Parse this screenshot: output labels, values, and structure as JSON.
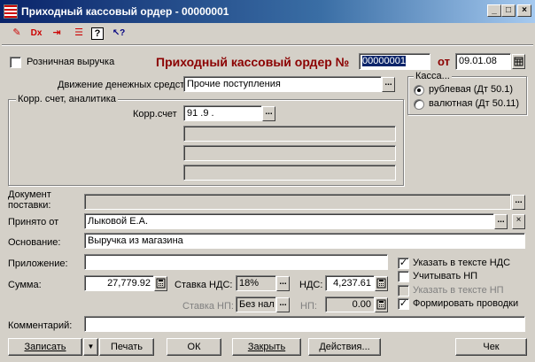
{
  "window": {
    "title": "Приходный кассовый ордер - 00000001",
    "minimize_icon": "_",
    "maximize_icon": "□",
    "close_icon": "×"
  },
  "toolbar": {
    "icons": [
      "doc-red-icon",
      "doc-x-icon",
      "doc-arrow-icon",
      "doc-lines-icon",
      "help-icon",
      "pointer-help-icon"
    ],
    "glyphs": [
      "✎",
      "Dx",
      "⇥",
      "☰",
      "?",
      "↖?"
    ]
  },
  "header": {
    "retail_label": "Розничная выручка",
    "retail_checked": false,
    "doc_title": "Приходный кассовый ордер №",
    "doc_number": "00000001",
    "date_label": "от",
    "date_value": "09.01.08"
  },
  "cash_flow": {
    "label": "Движение денежных средств",
    "value": "Прочие поступления",
    "button": "..."
  },
  "kassa": {
    "title": "Касса...",
    "options": [
      {
        "label": "рублевая (Дт 50.1)",
        "selected": true
      },
      {
        "label": "валютная (Дт 50.11)",
        "selected": false
      }
    ]
  },
  "account": {
    "group_title": "Корр. счет, аналитика",
    "label": "Корр.счет",
    "value": "91 .9 .",
    "button": "...",
    "subconto": [
      "",
      "",
      ""
    ]
  },
  "fields": {
    "doc_supply_label": "Документ поставки:",
    "doc_supply_value": "",
    "received_from_label": "Принято от",
    "received_from_value": "Лыковой Е.А.",
    "basis_label": "Основание:",
    "basis_value": "Выручка из магазина",
    "attachment_label": "Приложение:",
    "attachment_value": "",
    "sum_label": "Сумма:",
    "sum_value": "27,779.92",
    "vat_rate_label": "Ставка НДС:",
    "vat_rate_value": "18%",
    "vat_label": "НДС:",
    "vat_value": "4,237.61",
    "np_rate_label": "Ставка НП:",
    "np_rate_value": "Без нал",
    "np_label": "НП:",
    "np_value": "0.00",
    "comment_label": "Комментарий:",
    "comment_value": ""
  },
  "checkboxes": {
    "vat_in_text": {
      "label": "Указать в тексте НДС",
      "checked": true,
      "enabled": true
    },
    "account_np": {
      "label": "Учитывать НП",
      "checked": false,
      "enabled": true
    },
    "np_in_text": {
      "label": "Указать в тексте НП",
      "checked": false,
      "enabled": false
    },
    "make_entries": {
      "label": "Формировать проводки",
      "checked": true,
      "enabled": true
    }
  },
  "buttons": {
    "save": "Записать",
    "dropdown": "▼",
    "print": "Печать",
    "ok": "ОК",
    "close": "Закрыть",
    "actions": "Действия...",
    "check": "Чек"
  }
}
